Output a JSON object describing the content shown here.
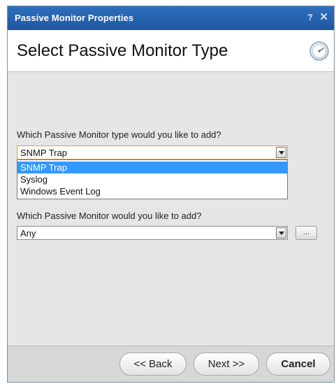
{
  "window": {
    "title": "Passive Monitor Properties",
    "help_glyph": "?",
    "close_glyph": "✕"
  },
  "header": {
    "title": "Select Passive Monitor Type",
    "icon": "gauge-icon"
  },
  "type_section": {
    "label": "Which Passive Monitor type would you like to add?",
    "selected": "SNMP Trap",
    "options": [
      "SNMP Trap",
      "Syslog",
      "Windows Event Log"
    ],
    "highlighted_index": 0
  },
  "monitor_section": {
    "label": "Which Passive Monitor would you like to add?",
    "selected": "Any",
    "browse_label": "..."
  },
  "footer": {
    "back_label": "<< Back",
    "next_label": "Next >>",
    "cancel_label": "Cancel"
  },
  "colors": {
    "titlebar": "#1f57a0",
    "selection": "#3399ff",
    "focus_border": "#d4a53a"
  }
}
